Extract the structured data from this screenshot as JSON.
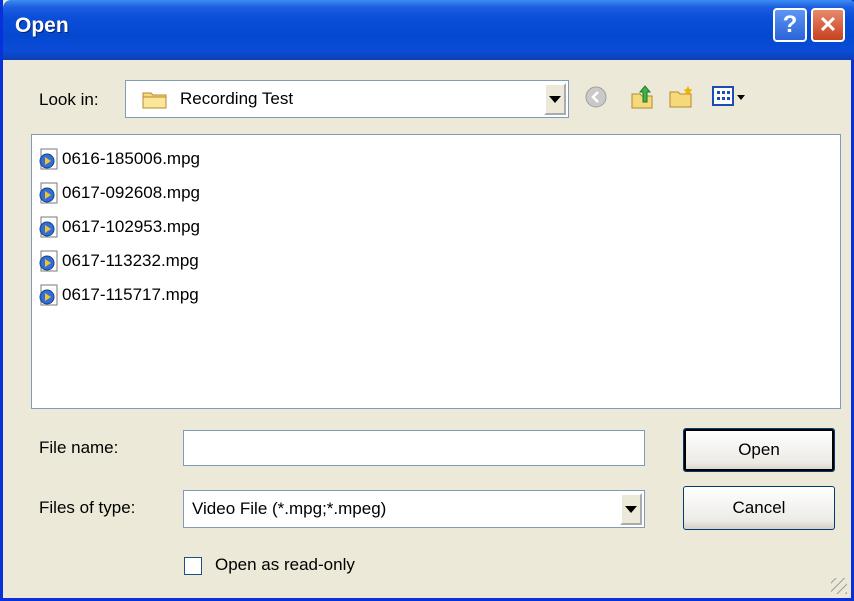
{
  "window": {
    "title": "Open"
  },
  "titlebar": {
    "help_label": "?",
    "close_label": "✕"
  },
  "lookin": {
    "label": "Look in:",
    "value": "Recording Test"
  },
  "files": [
    {
      "name": "0616-185006.mpg"
    },
    {
      "name": "0617-092608.mpg"
    },
    {
      "name": "0617-102953.mpg"
    },
    {
      "name": "0617-113232.mpg"
    },
    {
      "name": "0617-115717.mpg"
    }
  ],
  "filename": {
    "label": "File name:",
    "value": ""
  },
  "filetype": {
    "label": "Files of type:",
    "value": "Video File (*.mpg;*.mpeg)"
  },
  "buttons": {
    "open": "Open",
    "cancel": "Cancel"
  },
  "readonly": {
    "label": "Open as read-only",
    "checked": false
  },
  "icons": {
    "back": "back-arrow-icon",
    "up": "up-folder-icon",
    "new_folder": "new-folder-icon",
    "views": "views-menu-icon",
    "file": "video-file-icon"
  },
  "colors": {
    "titlebar": "#0A4ED8",
    "window_bg": "#ECE9D8",
    "close": "#C7401D"
  }
}
